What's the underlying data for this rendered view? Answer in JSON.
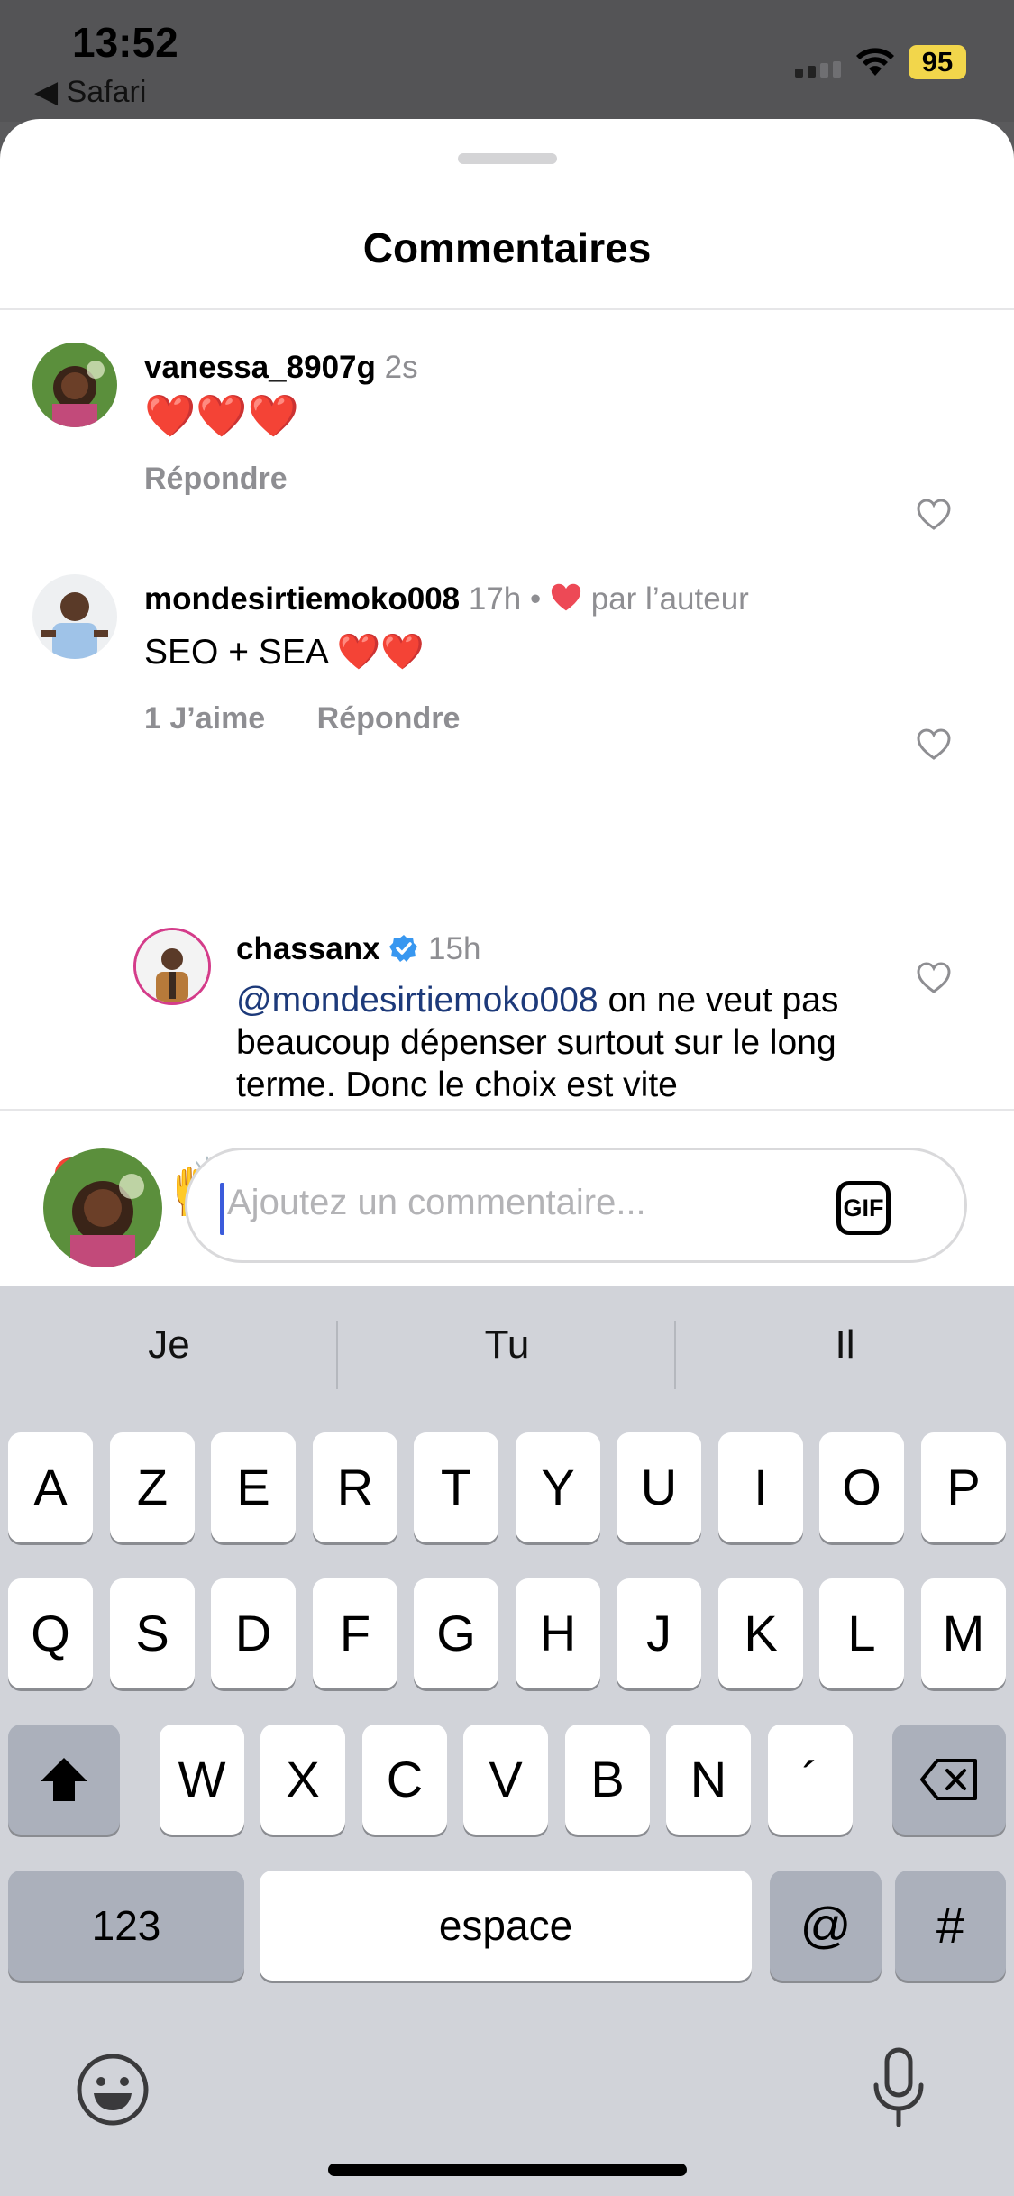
{
  "status_bar": {
    "time": "13:52",
    "back_app": "◀ Safari",
    "battery": "95"
  },
  "sheet": {
    "title": "Commentaires"
  },
  "comments": [
    {
      "username": "vanessa_8907g",
      "time": "2s",
      "text": "❤️❤️❤️",
      "actions": [
        "Répondre"
      ]
    },
    {
      "username": "mondesirtiemoko008",
      "time": "17h",
      "separator": "•",
      "author_like": "par l’auteur",
      "text": "SEO + SEA ❤️❤️",
      "likes": "1 J’aime",
      "actions": [
        "Répondre"
      ]
    },
    {
      "username": "chassanx",
      "verified": true,
      "time": "15h",
      "mention": "@mondesirtiemoko008",
      "text": " on ne veut pas beaucoup dépenser surtout sur le long terme. Donc le choix est vite"
    }
  ],
  "quick_emojis": [
    "❤️",
    "🙌",
    "🔥",
    "👏",
    "😢",
    "😍",
    "😮",
    "😂"
  ],
  "composer": {
    "placeholder": "Ajoutez un commentaire...",
    "gif_label": "GIF"
  },
  "keyboard": {
    "suggestions": [
      "Je",
      "Tu",
      "Il"
    ],
    "row1": [
      "A",
      "Z",
      "E",
      "R",
      "T",
      "Y",
      "U",
      "I",
      "O",
      "P"
    ],
    "row2": [
      "Q",
      "S",
      "D",
      "F",
      "G",
      "H",
      "J",
      "K",
      "L",
      "M"
    ],
    "row3": [
      "W",
      "X",
      "C",
      "V",
      "B",
      "N",
      "´"
    ],
    "numbers_key": "123",
    "space_key": "espace",
    "at_key": "@",
    "hash_key": "#"
  },
  "colors": {
    "like_red": "#ed4956",
    "verified_blue": "#3897f0",
    "cursor_blue": "#3b5bdb"
  }
}
